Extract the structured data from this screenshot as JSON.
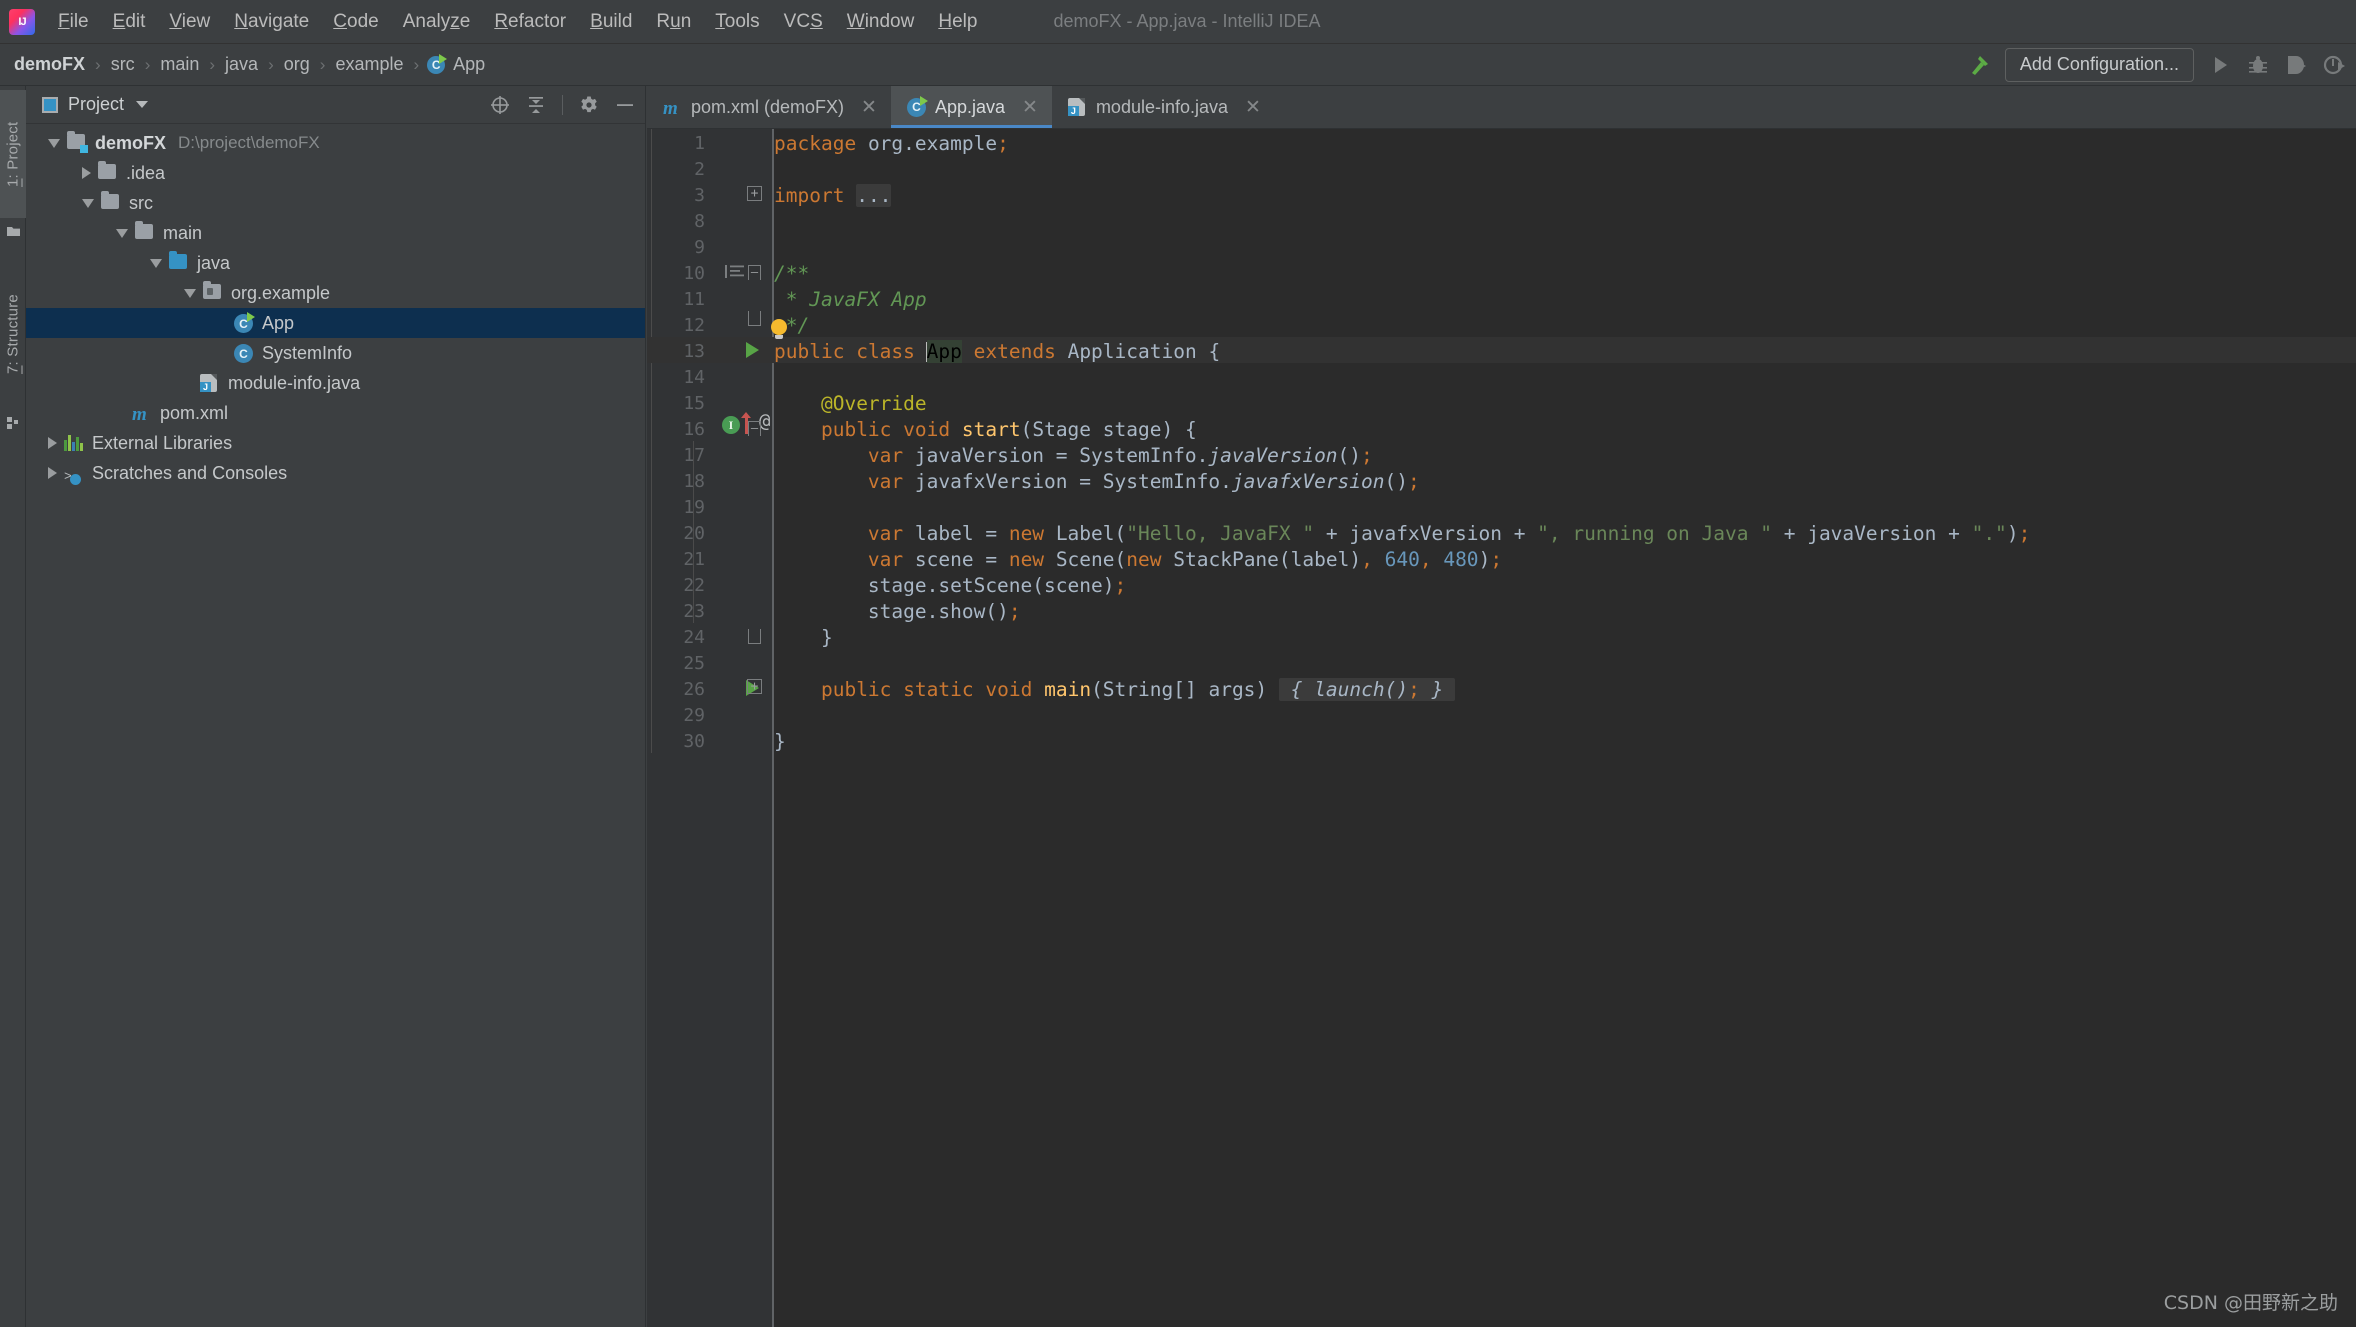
{
  "window": {
    "title": "demoFX - App.java - IntelliJ IDEA",
    "logo_icon": "intellij-idea-logo"
  },
  "menubar": {
    "items": [
      {
        "label": "File",
        "mnemonic": "F"
      },
      {
        "label": "Edit",
        "mnemonic": "E"
      },
      {
        "label": "View",
        "mnemonic": "V"
      },
      {
        "label": "Navigate",
        "mnemonic": "N"
      },
      {
        "label": "Code",
        "mnemonic": "C"
      },
      {
        "label": "Analyze",
        "mnemonic": "z"
      },
      {
        "label": "Refactor",
        "mnemonic": "R"
      },
      {
        "label": "Build",
        "mnemonic": "B"
      },
      {
        "label": "Run",
        "mnemonic": "u"
      },
      {
        "label": "Tools",
        "mnemonic": "T"
      },
      {
        "label": "VCS",
        "mnemonic": "S"
      },
      {
        "label": "Window",
        "mnemonic": "W"
      },
      {
        "label": "Help",
        "mnemonic": "H"
      }
    ]
  },
  "navbar": {
    "breadcrumbs": [
      {
        "label": "demoFX",
        "icon": null,
        "bold": true
      },
      {
        "label": "src",
        "icon": null,
        "bold": false
      },
      {
        "label": "main",
        "icon": null,
        "bold": false
      },
      {
        "label": "java",
        "icon": null,
        "bold": false
      },
      {
        "label": "org",
        "icon": null,
        "bold": false
      },
      {
        "label": "example",
        "icon": null,
        "bold": false
      },
      {
        "label": "App",
        "icon": "java-class-icon",
        "bold": false
      }
    ],
    "separator": "›",
    "build_icon": "hammer-build-icon",
    "run_config_label": "Add Configuration...",
    "actions": [
      {
        "name": "run-button",
        "icon": "play-icon",
        "enabled": false
      },
      {
        "name": "debug-button",
        "icon": "bug-icon",
        "enabled": false
      },
      {
        "name": "run-with-coverage-button",
        "icon": "coverage-icon",
        "enabled": false
      },
      {
        "name": "profile-button",
        "icon": "profiler-icon",
        "enabled": false
      }
    ]
  },
  "tool_stripe": {
    "buttons": [
      {
        "label": "1: Project",
        "mnemonic": "1",
        "icon": "project-folder-icon",
        "active": true
      },
      {
        "label": "7: Structure",
        "mnemonic": "7",
        "icon": "structure-icon",
        "active": false
      }
    ]
  },
  "project_panel": {
    "title": "Project",
    "title_icon": "project-view-icon",
    "dropdown_icon": "chevron-down-icon",
    "actions": [
      {
        "name": "scroll-from-source-button",
        "icon": "target-crosshair-icon"
      },
      {
        "name": "collapse-all-button",
        "icon": "collapse-all-icon"
      },
      {
        "name": "settings-button",
        "icon": "gear-icon"
      },
      {
        "name": "hide-button",
        "icon": "minus-icon"
      }
    ],
    "tree": [
      {
        "label": "demoFX",
        "path": "D:\\project\\demoFX",
        "indent": 0,
        "twisty": "open",
        "icon": "module-folder-icon",
        "bold": true,
        "selected": false
      },
      {
        "label": ".idea",
        "path": "",
        "indent": 1,
        "twisty": "closed",
        "icon": "folder-icon",
        "bold": false,
        "selected": false
      },
      {
        "label": "src",
        "path": "",
        "indent": 1,
        "twisty": "open",
        "icon": "folder-icon",
        "bold": false,
        "selected": false
      },
      {
        "label": "main",
        "path": "",
        "indent": 2,
        "twisty": "open",
        "icon": "folder-icon",
        "bold": false,
        "selected": false
      },
      {
        "label": "java",
        "path": "",
        "indent": 3,
        "twisty": "open",
        "icon": "source-folder-icon",
        "bold": false,
        "selected": false
      },
      {
        "label": "org.example",
        "path": "",
        "indent": 4,
        "twisty": "open",
        "icon": "package-icon",
        "bold": false,
        "selected": false
      },
      {
        "label": "App",
        "path": "",
        "indent": 5,
        "twisty": "none",
        "icon": "runnable-class-icon",
        "bold": false,
        "selected": true
      },
      {
        "label": "SystemInfo",
        "path": "",
        "indent": 5,
        "twisty": "none",
        "icon": "class-icon",
        "bold": false,
        "selected": false
      },
      {
        "label": "module-info.java",
        "path": "",
        "indent": 4,
        "twisty": "none",
        "icon": "module-info-icon",
        "bold": false,
        "selected": false
      },
      {
        "label": "pom.xml",
        "path": "",
        "indent": 2,
        "twisty": "none",
        "icon": "maven-icon",
        "bold": false,
        "selected": false
      },
      {
        "label": "External Libraries",
        "path": "",
        "indent": 0,
        "twisty": "closed",
        "icon": "libraries-icon",
        "bold": false,
        "selected": false
      },
      {
        "label": "Scratches and Consoles",
        "path": "",
        "indent": 0,
        "twisty": "closed",
        "icon": "scratches-icon",
        "bold": false,
        "selected": false
      }
    ]
  },
  "editor": {
    "tabs": [
      {
        "label": "pom.xml (demoFX)",
        "icon": "maven-icon",
        "active": false,
        "close_icon": "close-icon"
      },
      {
        "label": "App.java",
        "icon": "runnable-class-icon",
        "active": true,
        "close_icon": "close-icon"
      },
      {
        "label": "module-info.java",
        "icon": "module-info-icon",
        "active": false,
        "close_icon": "close-icon"
      }
    ],
    "filename": "App.java",
    "line_numbers": [
      "1",
      "2",
      "3",
      "8",
      "9",
      "10",
      "11",
      "12",
      "13",
      "14",
      "15",
      "16",
      "17",
      "18",
      "19",
      "20",
      "21",
      "22",
      "23",
      "24",
      "25",
      "26",
      "29",
      "30"
    ],
    "lines": [
      {
        "n": "1",
        "text": "package org.example;"
      },
      {
        "n": "2",
        "text": ""
      },
      {
        "n": "3",
        "text": "import ..."
      },
      {
        "n": "8",
        "text": ""
      },
      {
        "n": "9",
        "text": ""
      },
      {
        "n": "10",
        "text": "/**"
      },
      {
        "n": "11",
        "text": " * JavaFX App"
      },
      {
        "n": "12",
        "text": " */"
      },
      {
        "n": "13",
        "text": "public class App extends Application {"
      },
      {
        "n": "14",
        "text": ""
      },
      {
        "n": "15",
        "text": "    @Override"
      },
      {
        "n": "16",
        "text": "    public void start(Stage stage) {"
      },
      {
        "n": "17",
        "text": "        var javaVersion = SystemInfo.javaVersion();"
      },
      {
        "n": "18",
        "text": "        var javafxVersion = SystemInfo.javafxVersion();"
      },
      {
        "n": "19",
        "text": ""
      },
      {
        "n": "20",
        "text": "        var label = new Label(\"Hello, JavaFX \" + javafxVersion + \", running on Java \" + javaVersion + \".\");"
      },
      {
        "n": "21",
        "text": "        var scene = new Scene(new StackPane(label), 640, 480);"
      },
      {
        "n": "22",
        "text": "        stage.setScene(scene);"
      },
      {
        "n": "23",
        "text": "        stage.show();"
      },
      {
        "n": "24",
        "text": "    }"
      },
      {
        "n": "25",
        "text": ""
      },
      {
        "n": "26",
        "text": "    public static void main(String[] args) { launch(); }"
      },
      {
        "n": "29",
        "text": ""
      },
      {
        "n": "30",
        "text": "}"
      }
    ],
    "folded_import_placeholder": "...",
    "folded_main_body": "{ launch(); }",
    "caret_line": "13",
    "selected_word": "App",
    "gutter_marks": [
      {
        "line": "3",
        "icon": "fold-expand-icon"
      },
      {
        "line": "10",
        "icon": "doc-comment-icon"
      },
      {
        "line": "10",
        "icon": "fold-collapse-icon"
      },
      {
        "line": "12",
        "icon": "intention-bulb-icon"
      },
      {
        "line": "13",
        "icon": "run-class-icon"
      },
      {
        "line": "16",
        "icon": "overriding-method-icon"
      },
      {
        "line": "16",
        "icon": "annotation-at-icon"
      },
      {
        "line": "26",
        "icon": "run-method-icon"
      },
      {
        "line": "26",
        "icon": "fold-expand-icon"
      }
    ]
  },
  "watermark": "CSDN @田野新之助",
  "colors": {
    "chrome_bg": "#3c3f41",
    "editor_bg": "#2b2b2b",
    "gutter_bg": "#313335",
    "tab_active_bg": "#4e5254",
    "tab_underline": "#4a88c7",
    "tree_selection": "#0d2f4f",
    "keyword": "#cc7832",
    "string": "#6a8759",
    "comment": "#629755",
    "number": "#6897bb",
    "annotation": "#bbb529",
    "method": "#ffc66d",
    "plain": "#a9b7c6",
    "run_green": "#58a446"
  }
}
